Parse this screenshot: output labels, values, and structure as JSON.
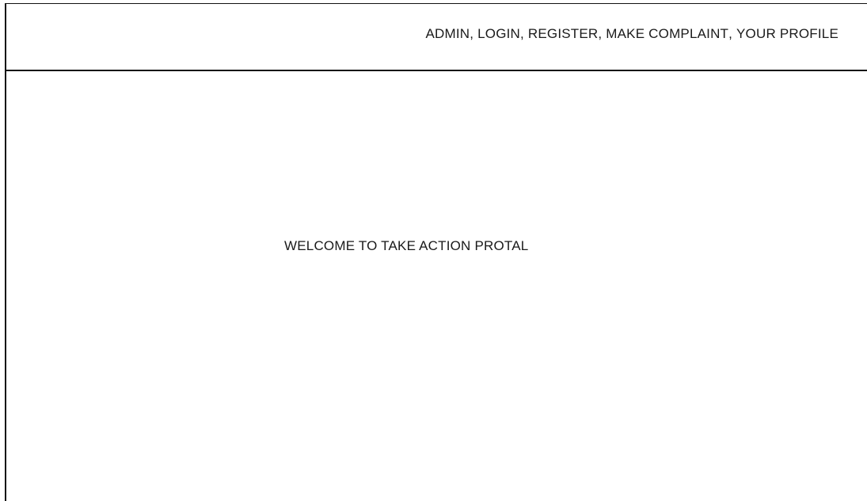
{
  "header": {
    "nav": [
      {
        "label": "ADMIN"
      },
      {
        "label": "LOGIN"
      },
      {
        "label": "REGISTER"
      },
      {
        "label": "MAKE COMPLAINT"
      },
      {
        "label": "YOUR PROFILE"
      }
    ],
    "separator": ", "
  },
  "main": {
    "welcome_text": "WELCOME TO TAKE ACTION PROTAL"
  }
}
